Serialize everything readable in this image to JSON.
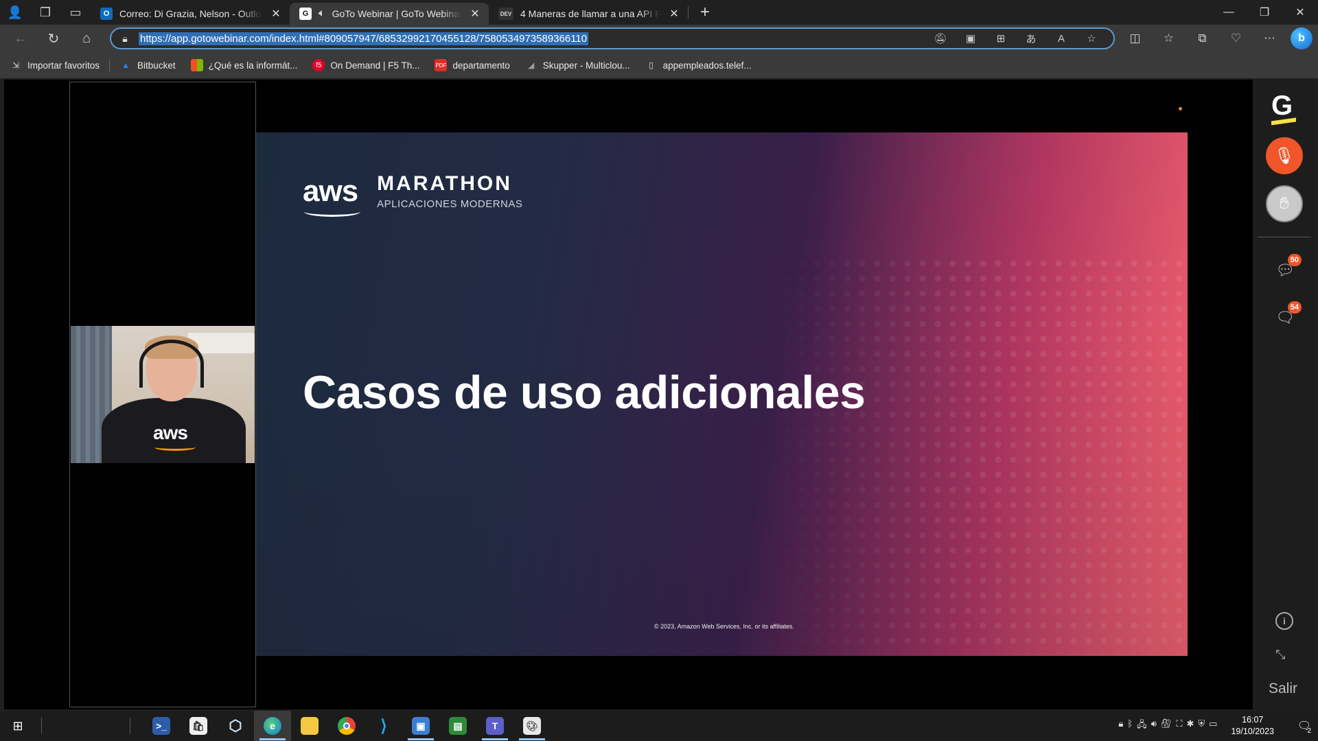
{
  "browser": {
    "tabs": [
      {
        "title": "Correo: Di Grazia, Nelson - Outlook",
        "favicon": "outlook-icon",
        "active": false
      },
      {
        "title": "GoTo Webinar | GoTo Webinar",
        "favicon": "goto-icon",
        "active": true,
        "muted_icon": "speaker-icon"
      },
      {
        "title": "4 Maneras de llamar a una API REST",
        "favicon": "dev-icon",
        "favicon_text": "DEV",
        "active": false
      }
    ],
    "url": "https://app.gotowebinar.com/index.html#809057947/6853299217045512 8/7580534973589366110",
    "url_display": "https://app.gotowebinar.com/index.html#809057947/68532992170455128/7580534973589366110",
    "favorites": [
      {
        "label": "Importar favoritos",
        "icon": "import-icon"
      },
      {
        "label": "Bitbucket",
        "icon": "bitbucket-icon"
      },
      {
        "label": "¿Qué es la informát...",
        "icon": "windows-icon"
      },
      {
        "label": "On Demand | F5 Th...",
        "icon": "f5-icon"
      },
      {
        "label": "departamento",
        "icon": "pdf-icon"
      },
      {
        "label": "Skupper - Multiclou...",
        "icon": "skupper-icon"
      },
      {
        "label": "appempleados.telef...",
        "icon": "page-icon"
      }
    ]
  },
  "slide": {
    "logo_text": "aws",
    "brand_name": "MARATHON",
    "brand_sub": "APLICACIONES MODERNAS",
    "title": "Casos de uso adicionales",
    "copyright": "© 2023, Amazon Web Services, Inc. or its affiliates."
  },
  "webcam": {
    "shirt_text": "aws"
  },
  "goto_sidebar": {
    "logo": "G",
    "questions_badge": "50",
    "chat_badge": "54",
    "exit_label": "Salir"
  },
  "taskbar": {
    "time": "16:07",
    "date": "19/10/2023",
    "notifications": "2"
  }
}
